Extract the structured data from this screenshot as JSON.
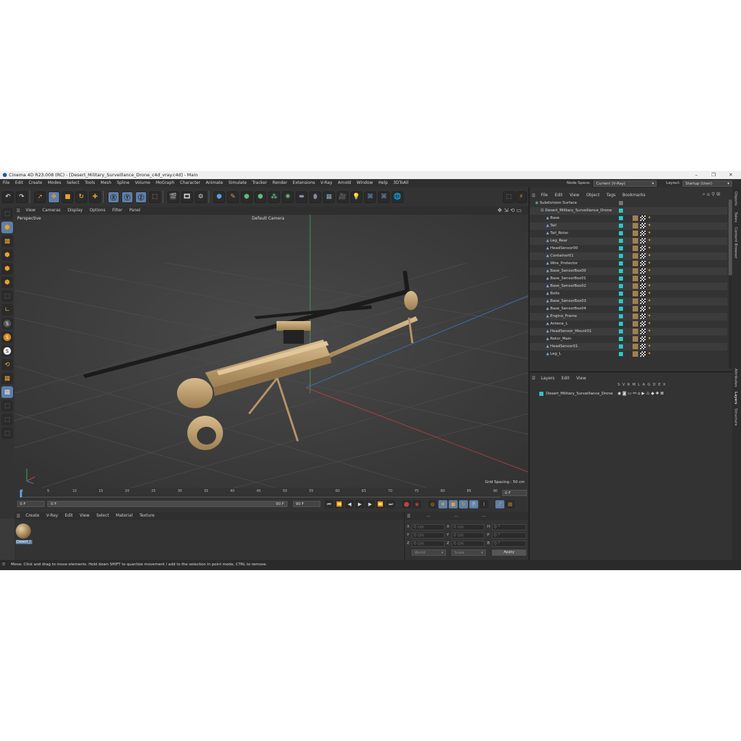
{
  "window": {
    "title": "Cinema 4D R23.008 (RC) - [Desert_Military_Surveillance_Drone_c4d_vray.c4d] - Main",
    "minimize": "–",
    "maximize": "❐",
    "close": "✕"
  },
  "menu": [
    "File",
    "Edit",
    "Create",
    "Modes",
    "Select",
    "Tools",
    "Mesh",
    "Spline",
    "Volume",
    "MoGraph",
    "Character",
    "Animate",
    "Simulate",
    "Tracker",
    "Render",
    "Extensions",
    "V-Ray",
    "Arnold",
    "Window",
    "Help",
    "3DToAll"
  ],
  "node_space": {
    "label": "Node Space:",
    "value": "Current (V-Ray)"
  },
  "layout": {
    "label": "Layout:",
    "value": "Startup (User)"
  },
  "viewport": {
    "menu": [
      "View",
      "Cameras",
      "Display",
      "Options",
      "Filter",
      "Panel"
    ],
    "view_name": "Perspective",
    "camera": "Default Camera",
    "grid_spacing": "Grid Spacing : 50 cm"
  },
  "timeline": {
    "ticks": [
      "0",
      "5",
      "10",
      "15",
      "20",
      "25",
      "30",
      "35",
      "40",
      "45",
      "50",
      "55",
      "60",
      "65",
      "70",
      "75",
      "80",
      "85",
      "90"
    ],
    "current_frame": "0 F",
    "start_frame": "0 F",
    "range_start": "0 F",
    "range_end": "90 F",
    "end_frame": "90 F",
    "frame_right": "0 F"
  },
  "material_manager": {
    "menu": [
      "Create",
      "V-Ray",
      "Edit",
      "View",
      "Select",
      "Material",
      "Texture"
    ],
    "material_name": "Desert_I"
  },
  "coordinates": {
    "rows": [
      [
        "X",
        "0 cm",
        "X",
        "0 cm",
        "H",
        "0 °"
      ],
      [
        "Y",
        "0 cm",
        "Y",
        "0 cm",
        "P",
        "0 °"
      ],
      [
        "Z",
        "0 cm",
        "Z",
        "0 cm",
        "B",
        "0 °"
      ]
    ],
    "mode1": "World",
    "mode2": "Scale",
    "apply": "Apply"
  },
  "status": "Move: Click and drag to move elements. Hold down SHIFT to quantize movement / add to the selection in point mode, CTRL to remove.",
  "objects_panel": {
    "menu": [
      "File",
      "Edit",
      "View",
      "Object",
      "Tags",
      "Bookmarks"
    ],
    "items": [
      "Subdivision Surface",
      "Desert_Military_Surveillance_Drone",
      "Base",
      "Tail",
      "Tail_Rotor",
      "Leg_Rear",
      "HeadSensor00",
      "Container01",
      "Wire_Protector",
      "Base_SensorBox00",
      "Base_SensorBox01",
      "Base_SensorBox02",
      "Bolts",
      "Base_SensorBox03",
      "Base_SensorBox04",
      "Engine_Frame",
      "Antena_L",
      "HeadSensor_Mount01",
      "Rotor_Main",
      "HeadSensor01",
      "Leg_L"
    ]
  },
  "layers_panel": {
    "menu": [
      "Layers",
      "Edit",
      "View"
    ],
    "columns": [
      "S",
      "V",
      "R",
      "M",
      "L",
      "A",
      "G",
      "D",
      "E",
      "X"
    ],
    "layer": "Desert_Military_Surveillance_Drone"
  },
  "side_tabs": [
    "Objects",
    "Takes",
    "Content Browser",
    "Attributes",
    "Layers",
    "Structure"
  ]
}
